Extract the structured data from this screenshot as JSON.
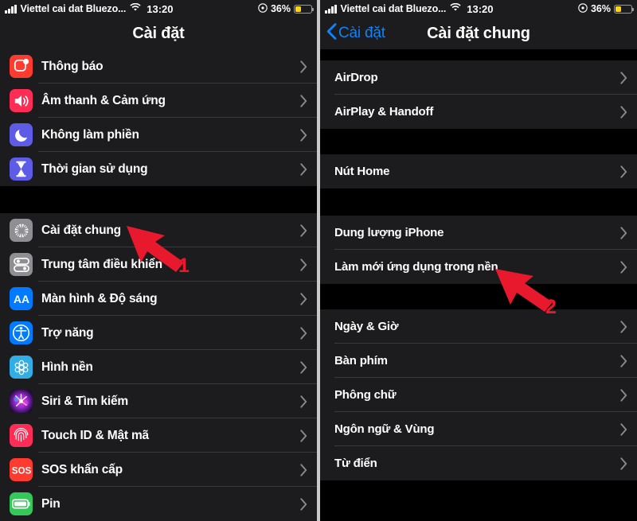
{
  "status_bar": {
    "carrier": "Viettel cai dat Bluezo...",
    "time": "13:20",
    "battery_percent": "36%",
    "wifi_icon": "wifi-icon",
    "signal_icon": "cellular-signal-icon",
    "alarm_icon": "alarm-clock-icon",
    "battery_icon": "battery-low-power-icon",
    "battery_color": "#ffd60a"
  },
  "left_panel": {
    "nav": {
      "title": "Cài đặt"
    },
    "groups": [
      {
        "rows": [
          {
            "label": "Thông báo",
            "icon": "notifications-icon",
            "icon_bg": "#ff3b30"
          },
          {
            "label": "Âm thanh & Cảm ứng",
            "icon": "sounds-haptics-icon",
            "icon_bg": "#ff2d55"
          },
          {
            "label": "Không làm phiền",
            "icon": "do-not-disturb-icon",
            "icon_bg": "#5e5ce6"
          },
          {
            "label": "Thời gian sử dụng",
            "icon": "screen-time-icon",
            "icon_bg": "#5e5ce6"
          }
        ]
      },
      {
        "rows": [
          {
            "label": "Cài đặt chung",
            "icon": "gear-icon",
            "icon_bg": "#8e8e93"
          },
          {
            "label": "Trung tâm điều khiển",
            "icon": "control-center-icon",
            "icon_bg": "#8e8e93"
          },
          {
            "label": "Màn hình & Độ sáng",
            "icon": "display-brightness-icon",
            "icon_bg": "#007aff"
          },
          {
            "label": "Trợ năng",
            "icon": "accessibility-icon",
            "icon_bg": "#007aff"
          },
          {
            "label": "Hình nền",
            "icon": "wallpaper-icon",
            "icon_bg": "#32ade6"
          },
          {
            "label": "Siri & Tìm kiếm",
            "icon": "siri-icon",
            "icon_bg": "#1c1c3a"
          },
          {
            "label": "Touch ID & Mật mã",
            "icon": "touch-id-icon",
            "icon_bg": "#ff2d55"
          },
          {
            "label": "SOS khẩn cấp",
            "icon": "sos-icon",
            "icon_bg": "#ff3b30"
          },
          {
            "label": "Pin",
            "icon": "battery-icon",
            "icon_bg": "#34c759"
          }
        ]
      }
    ]
  },
  "right_panel": {
    "nav": {
      "back_label": "Cài đặt",
      "title": "Cài đặt chung",
      "back_icon": "chevron-left-icon"
    },
    "groups": [
      {
        "rows": [
          {
            "label": "AirDrop"
          },
          {
            "label": "AirPlay & Handoff"
          }
        ]
      },
      {
        "rows": [
          {
            "label": "Nút Home"
          }
        ]
      },
      {
        "rows": [
          {
            "label": "Dung lượng iPhone"
          },
          {
            "label": "Làm mới ứng dụng trong nền"
          }
        ]
      },
      {
        "rows": [
          {
            "label": "Ngày & Giờ"
          },
          {
            "label": "Bàn phím"
          },
          {
            "label": "Phông chữ"
          },
          {
            "label": "Ngôn ngữ & Vùng"
          },
          {
            "label": "Từ điển"
          }
        ]
      }
    ]
  },
  "annotations": [
    {
      "number": "1",
      "color": "#e8192c",
      "target": "Cài đặt chung"
    },
    {
      "number": "2",
      "color": "#e8192c",
      "target": "Làm mới ứng dụng trong nền"
    }
  ]
}
